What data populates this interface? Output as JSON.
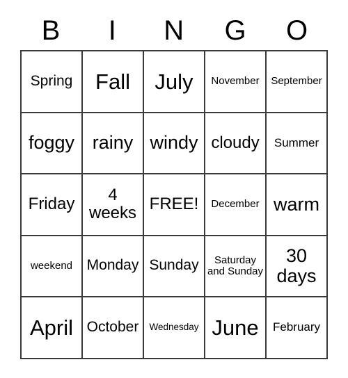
{
  "card": {
    "header_letters": [
      "B",
      "I",
      "N",
      "G",
      "O"
    ],
    "free_space_label": "FREE!",
    "grid": [
      [
        {
          "text": "Spring",
          "size": "md"
        },
        {
          "text": "Fall",
          "size": "xxl"
        },
        {
          "text": "July",
          "size": "xxl"
        },
        {
          "text": "November",
          "size": "xs"
        },
        {
          "text": "September",
          "size": "xs"
        }
      ],
      [
        {
          "text": "foggy",
          "size": "xl"
        },
        {
          "text": "rainy",
          "size": "xl"
        },
        {
          "text": "windy",
          "size": "xl"
        },
        {
          "text": "cloudy",
          "size": "lg"
        },
        {
          "text": "Summer",
          "size": "sm"
        }
      ],
      [
        {
          "text": "Friday",
          "size": "lg"
        },
        {
          "text": "4 weeks",
          "size": "lg"
        },
        {
          "text": "FREE!",
          "size": "lg"
        },
        {
          "text": "December",
          "size": "xs"
        },
        {
          "text": "warm",
          "size": "xl"
        }
      ],
      [
        {
          "text": "weekend",
          "size": "xs"
        },
        {
          "text": "Monday",
          "size": "md"
        },
        {
          "text": "Sunday",
          "size": "md"
        },
        {
          "text": "Saturday and Sunday",
          "size": "xs"
        },
        {
          "text": "30 days",
          "size": "xl"
        }
      ],
      [
        {
          "text": "April",
          "size": "xxl"
        },
        {
          "text": "October",
          "size": "md"
        },
        {
          "text": "Wednesday",
          "size": "xxs"
        },
        {
          "text": "June",
          "size": "xxl"
        },
        {
          "text": "February",
          "size": "sm"
        }
      ]
    ]
  }
}
